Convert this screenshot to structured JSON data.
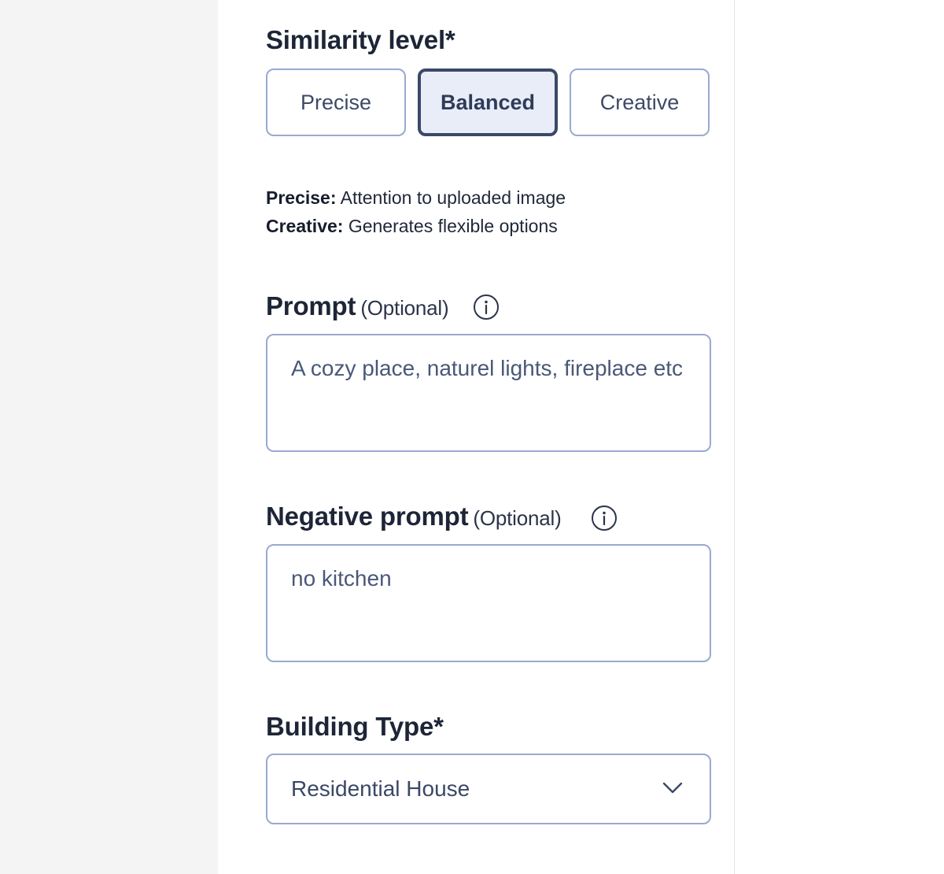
{
  "similarity": {
    "label": "Similarity level*",
    "options": [
      {
        "label": "Precise",
        "selected": false
      },
      {
        "label": "Balanced",
        "selected": true
      },
      {
        "label": "Creative",
        "selected": false
      }
    ],
    "descriptions": [
      {
        "term": "Precise:",
        "text": " Attention to uploaded image"
      },
      {
        "term": "Creative:",
        "text": " Generates flexible options"
      }
    ]
  },
  "prompt": {
    "label": "Prompt",
    "optional": "(Optional)",
    "value": "A cozy place, naturel lights, fireplace etc",
    "icon": "info-icon"
  },
  "negative_prompt": {
    "label": "Negative prompt",
    "optional": "(Optional)",
    "value": "no kitchen",
    "icon": "info-icon"
  },
  "building_type": {
    "label": "Building Type*",
    "selected": "Residential House",
    "icon": "chevron-down-icon"
  },
  "colors": {
    "border": "#9aa9d0",
    "active_border": "#3c4868",
    "active_bg": "#e9edf7",
    "heading": "#1d2537",
    "gutter": "#f4f4f4"
  }
}
